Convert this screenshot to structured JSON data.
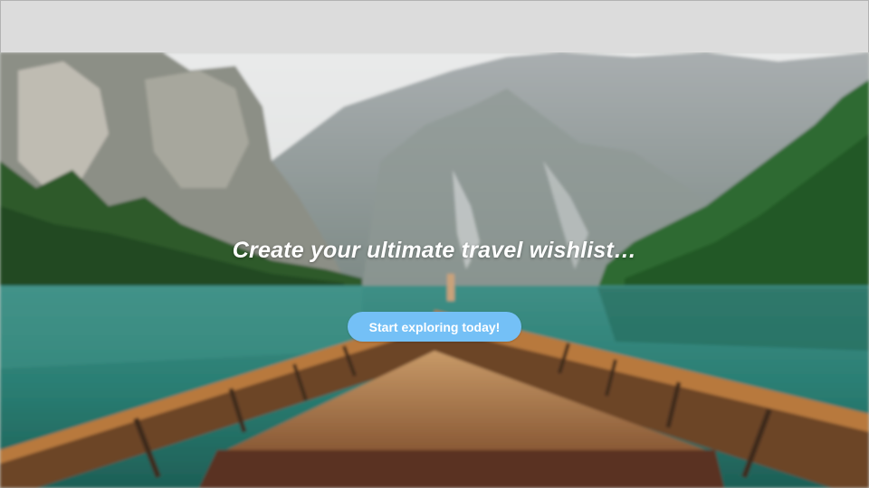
{
  "header": {
    "background_color": "#dcdcdc"
  },
  "hero": {
    "background_image": "mountain-lake-boat",
    "title": "Create your ultimate travel wishlist…",
    "cta_label": "Start exploring today!",
    "cta_color": "#74c0f6"
  }
}
